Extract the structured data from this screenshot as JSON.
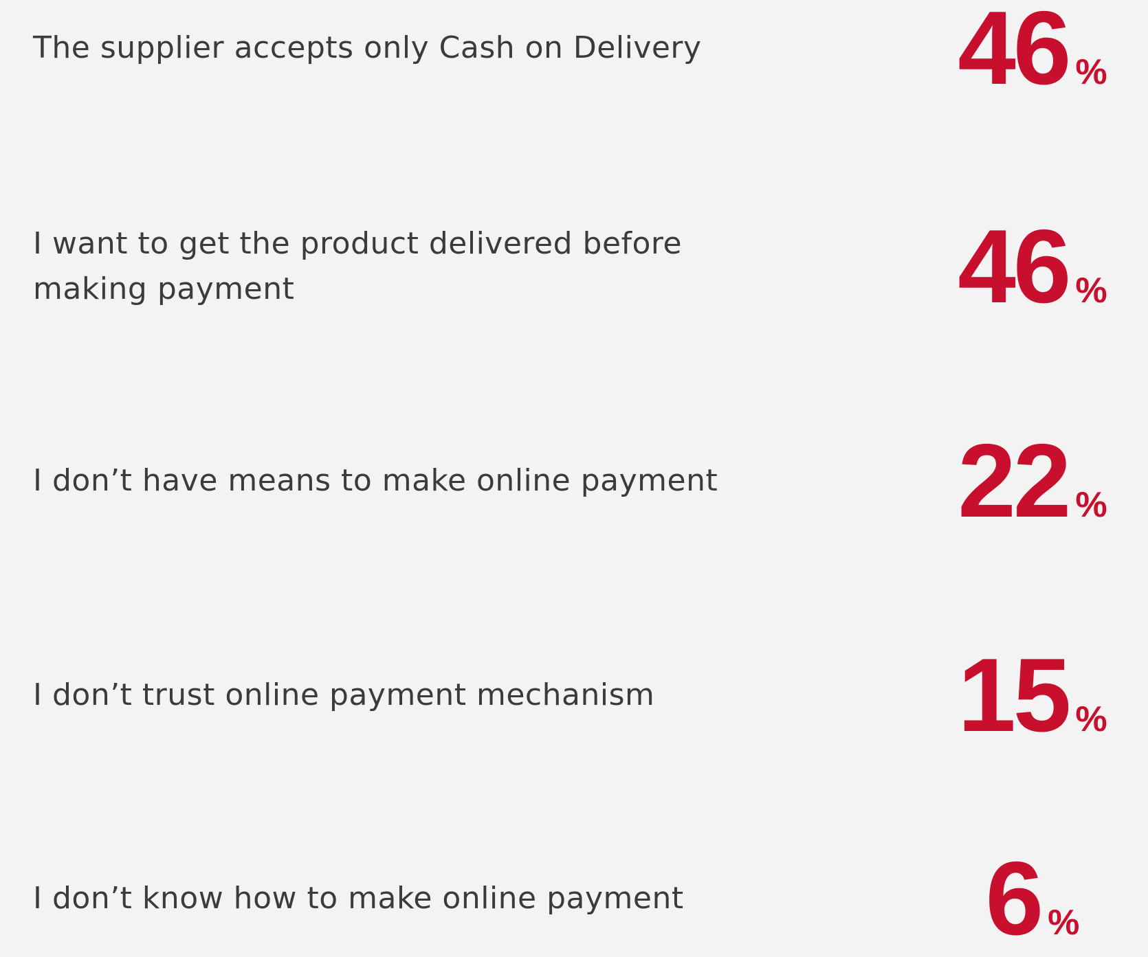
{
  "chart_data": {
    "type": "table",
    "unit": "%",
    "rows": [
      {
        "label": "The supplier accepts only Cash on Delivery",
        "value": 46,
        "display": "46",
        "unit": "%"
      },
      {
        "label": "I want to get the product delivered before making payment",
        "value": 46,
        "display": "46",
        "unit": "%"
      },
      {
        "label": "I don’t have means to make online payment",
        "value": 22,
        "display": "22",
        "unit": "%"
      },
      {
        "label": "I don’t trust online payment mechanism",
        "value": 15,
        "display": "15",
        "unit": "%"
      },
      {
        "label": "I don’t know how to make online payment",
        "value": 6,
        "display": "6",
        "unit": "%"
      }
    ]
  },
  "colors": {
    "background": "#f3f3f3",
    "label_text": "#3c3b3b",
    "value_accent": "#c8102e"
  }
}
